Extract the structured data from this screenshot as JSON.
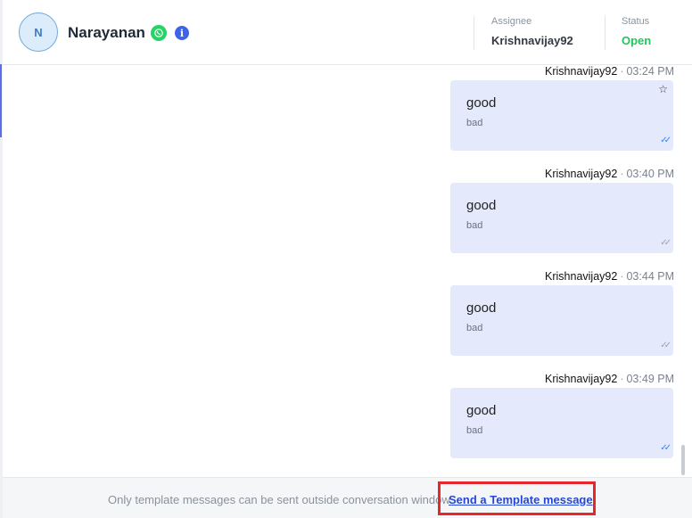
{
  "contact": {
    "avatar_initial": "N",
    "name": "Narayanan",
    "channel_icon": "whatsapp-icon",
    "info_icon": "info-icon"
  },
  "meta": {
    "assignee_label": "Assignee",
    "assignee_value": "Krishnavijay92",
    "status_label": "Status",
    "status_value": "Open",
    "status_color": "#22c55e"
  },
  "messages": [
    {
      "sender": "Krishnavijay92",
      "time": "03:24 PM",
      "text": "good",
      "sub": "bad",
      "starred": true,
      "read": true
    },
    {
      "sender": "Krishnavijay92",
      "time": "03:40 PM",
      "text": "good",
      "sub": "bad",
      "starred": false,
      "read": false
    },
    {
      "sender": "Krishnavijay92",
      "time": "03:44 PM",
      "text": "good",
      "sub": "bad",
      "starred": false,
      "read": false
    },
    {
      "sender": "Krishnavijay92",
      "time": "03:49 PM",
      "text": "good",
      "sub": "bad",
      "starred": false,
      "read": true
    }
  ],
  "footer": {
    "note": "Only template messages can be sent outside conversation window",
    "template_link": "Send a Template message"
  },
  "colors": {
    "bubble": "#e4e9fb",
    "read_ticks": "#3b82f6",
    "unread_ticks": "#9ca3af",
    "highlight_border": "#e8262b"
  }
}
